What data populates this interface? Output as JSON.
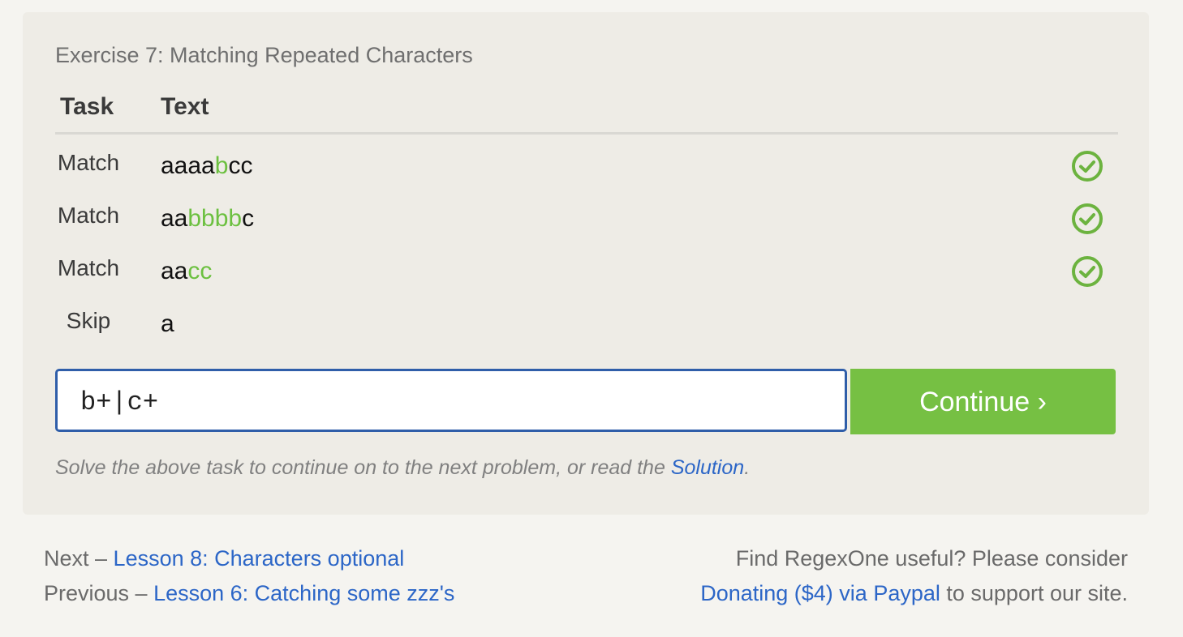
{
  "exercise": {
    "title": "Exercise 7: Matching Repeated Characters"
  },
  "table": {
    "headers": {
      "task": "Task",
      "text": "Text"
    },
    "rows": [
      {
        "task": "Match",
        "segments": [
          "aaaa",
          "b",
          "cc"
        ],
        "matched": true
      },
      {
        "task": "Match",
        "segments": [
          "aa",
          "bbbb",
          "c"
        ],
        "matched": true
      },
      {
        "task": "Match",
        "segments": [
          "aa",
          "cc",
          ""
        ],
        "matched": true
      },
      {
        "task": "Skip",
        "segments": [
          "a",
          "",
          ""
        ],
        "matched": false
      }
    ]
  },
  "input": {
    "value": "b+|c+"
  },
  "continue_button": {
    "label": "Continue ›"
  },
  "hint": {
    "text": "Solve the above task to continue on to the next problem, or read the ",
    "link": "Solution",
    "end": "."
  },
  "footer": {
    "next_prefix": "Next – ",
    "next_link": "Lesson 8: Characters optional",
    "prev_prefix": "Previous – ",
    "prev_link": "Lesson 6: Catching some zzz's",
    "donate_line1": "Find RegexOne useful? Please consider",
    "donate_link": "Donating ($4) via Paypal",
    "donate_suffix": " to support our site."
  },
  "colors": {
    "highlight": "#6cc040",
    "link": "#2c66c7",
    "button": "#76c043",
    "input_border": "#2f5ea9"
  },
  "icons": {
    "check": "check-circle-icon"
  }
}
